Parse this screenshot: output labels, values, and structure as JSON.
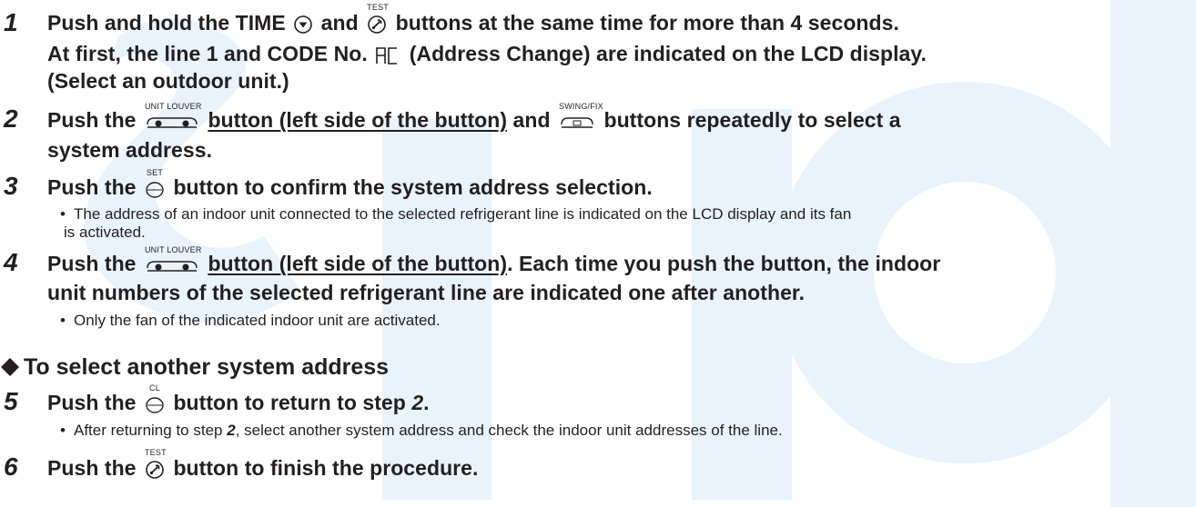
{
  "steps": [
    {
      "number": "1",
      "line1_a": "Push and hold the TIME",
      "line1_b": "and",
      "line1_c": "buttons at the same time for more than 4 seconds.",
      "line2_a": "At first, the line 1 and CODE No.",
      "code_display": "AC",
      "line2_b": "(Address Change) are indicated on the LCD display.",
      "line3": "(Select an outdoor unit.)"
    },
    {
      "number": "2",
      "line1_a": "Push the",
      "line1_u": "button (left side of the button)",
      "line1_b": "and",
      "line1_c": "buttons repeatedly to select a",
      "line2": "system address."
    },
    {
      "number": "3",
      "line1_a": "Push the",
      "line1_b": "button to confirm the system address selection.",
      "bullet_1": "The address of an indoor unit connected to the selected refrigerant line is indicated on the LCD display and its fan",
      "bullet_1_cont": "is activated."
    },
    {
      "number": "4",
      "line1_a": "Push the",
      "line1_u": "button (left side of the button)",
      "line1_b": ". Each time you push the button, the indoor",
      "line2": "unit numbers of the selected refrigerant line are indicated one after another.",
      "bullet_1": "Only the fan of the indicated indoor unit are activated."
    },
    {
      "number": "5",
      "line1_a": "Push the",
      "line1_b": "button to return to step",
      "line1_ref": "2",
      "line1_end": ".",
      "bullet_a": "After returning to step",
      "bullet_ref": "2",
      "bullet_b": ", select another system address and check the indoor unit addresses of the line."
    },
    {
      "number": "6",
      "line1_a": "Push the",
      "line1_b": "button to finish the procedure."
    }
  ],
  "section_heading": "To select another system address",
  "button_captions": {
    "test": "TEST",
    "unit_louver_left": "UNIT",
    "unit_louver_right": "LOUVER",
    "swing_fix": "SWING/FIX",
    "set": "SET",
    "cl": "CL"
  },
  "bullet_glyph": "•",
  "colors": {
    "text": "#231f20",
    "watermark": "#e6f2fa"
  }
}
